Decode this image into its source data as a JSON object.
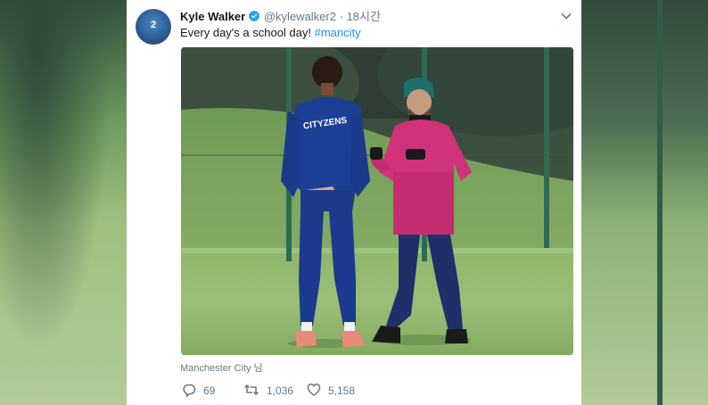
{
  "tweet": {
    "author_name": "Kyle Walker",
    "handle": "@kylewalker2",
    "separator": "·",
    "time": "18시간",
    "text_prefix": "Every day's a school day! ",
    "hashtag": "#mancity",
    "location": "Manchester City 님",
    "avatar_number": "2",
    "jersey_text": "CITYZENS"
  },
  "actions": {
    "replies": "69",
    "retweets": "1,036",
    "likes": "5,158"
  },
  "colors": {
    "link": "#1b95e0",
    "muted": "#657786",
    "text": "#14171a",
    "verified": "#1da1f2"
  }
}
